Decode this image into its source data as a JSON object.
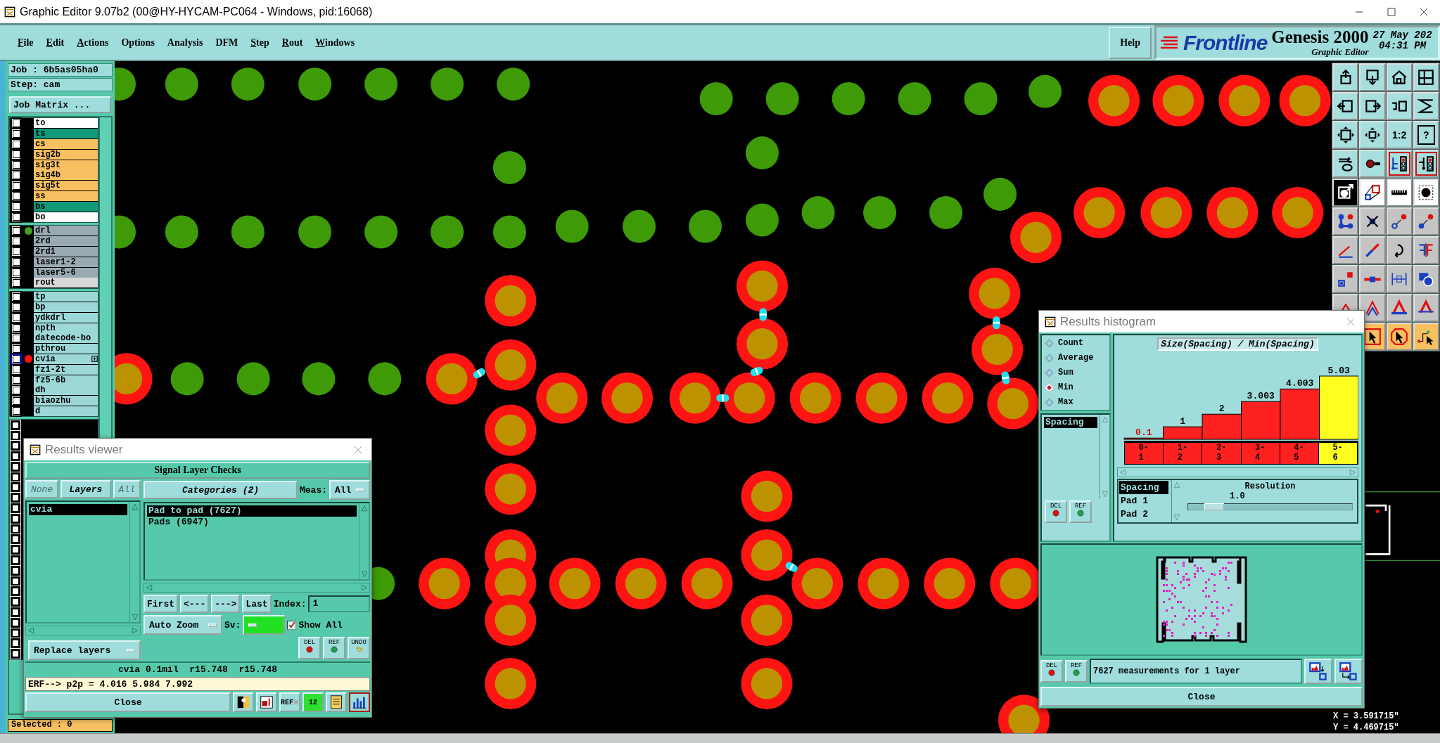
{
  "window": {
    "title": "Graphic Editor 9.07b2 (00@HY-HYCAM-PC064 - Windows, pid:16068)"
  },
  "menu": [
    {
      "label": "File",
      "mnemonic": true
    },
    {
      "label": "Edit",
      "mnemonic": true
    },
    {
      "label": "Actions",
      "mnemonic": true
    },
    {
      "label": "Options",
      "mnemonic": false
    },
    {
      "label": "Analysis",
      "mnemonic": false
    },
    {
      "label": "DFM",
      "mnemonic": false
    },
    {
      "label": "Step",
      "mnemonic": true
    },
    {
      "label": "Rout",
      "mnemonic": true
    },
    {
      "label": "Windows",
      "mnemonic": true
    }
  ],
  "help": "Help",
  "brand": {
    "logo": "Frontline",
    "product": "Genesis 2000",
    "subtitle": "Graphic Editor",
    "date": "27 May 202",
    "time": "04:31 PM"
  },
  "job": {
    "job": "Job : 6b5as05ha0",
    "step": "Step: cam",
    "matrix_button": "Job Matrix ..."
  },
  "layer_groups": [
    {
      "layers": [
        {
          "name": "to",
          "color": "#ffffff",
          "checked": false,
          "focused": false
        },
        {
          "name": "ts",
          "color": "#119a7a",
          "checked": false,
          "focused": false
        },
        {
          "name": "cs",
          "color": "#f8c060",
          "checked": false,
          "focused": false
        },
        {
          "name": "sig2b",
          "color": "#f8c060",
          "checked": false,
          "focused": false
        },
        {
          "name": "sig3t",
          "color": "#f8c060",
          "checked": false,
          "focused": false
        },
        {
          "name": "sig4b",
          "color": "#f8c060",
          "checked": false,
          "focused": false
        },
        {
          "name": "sig5t",
          "color": "#f8c060",
          "checked": false,
          "focused": false
        },
        {
          "name": "ss",
          "color": "#f8c060",
          "checked": false,
          "focused": false
        },
        {
          "name": "bs",
          "color": "#119a7a",
          "checked": false,
          "focused": false
        },
        {
          "name": "bo",
          "color": "#ffffff",
          "checked": false,
          "focused": false
        }
      ]
    },
    {
      "layers": [
        {
          "name": "drl",
          "color": "#9aaab2",
          "checked": false,
          "focused": false,
          "dot": {
            "color": "#40a020"
          }
        },
        {
          "name": "2rd",
          "color": "#9aaab2",
          "checked": false,
          "focused": false
        },
        {
          "name": "2rd1",
          "color": "#9aaab2",
          "checked": false,
          "focused": false
        },
        {
          "name": "laser1-2",
          "color": "#9aaab2",
          "checked": false,
          "focused": false
        },
        {
          "name": "laser5-6",
          "color": "#9aaab2",
          "checked": false,
          "focused": false
        },
        {
          "name": "rout",
          "color": "#d8d8d8",
          "checked": false,
          "focused": false
        }
      ]
    },
    {
      "layers": [
        {
          "name": "tp",
          "color": "#9cd8d8",
          "checked": false,
          "focused": false
        },
        {
          "name": "bp",
          "color": "#9cd8d8",
          "checked": false,
          "focused": false
        },
        {
          "name": "ydkdrl",
          "color": "#9cd8d8",
          "checked": false,
          "focused": false
        },
        {
          "name": "npth",
          "color": "#9cd8d8",
          "checked": false,
          "focused": false
        },
        {
          "name": "datecode-bo",
          "color": "#9cd8d8",
          "checked": false,
          "focused": false
        },
        {
          "name": "pthrou",
          "color": "#9cd8d8",
          "checked": false,
          "focused": false
        },
        {
          "name": "cvia",
          "color": "#9cd8d8",
          "checked": false,
          "focused": true,
          "dot": {
            "color": "#ff1010"
          },
          "expandable": true
        },
        {
          "name": "fz1-2t",
          "color": "#9cd8d8",
          "checked": false,
          "focused": false
        },
        {
          "name": "fz5-6b",
          "color": "#9cd8d8",
          "checked": false,
          "focused": false
        },
        {
          "name": "dh",
          "color": "#9cd8d8",
          "checked": false,
          "focused": false
        },
        {
          "name": "biaozhu",
          "color": "#9cd8d8",
          "checked": false,
          "focused": false
        },
        {
          "name": "d",
          "color": "#9cd8d8",
          "checked": false,
          "focused": false
        }
      ]
    }
  ],
  "extra_rows": [
    {
      "checked": false
    },
    {
      "checked": false
    },
    {
      "checked": false
    },
    {
      "checked": false
    },
    {
      "checked": false
    },
    {
      "checked": false
    },
    {
      "checked": false
    },
    {
      "checked": false
    },
    {
      "checked": false
    },
    {
      "checked": false
    },
    {
      "checked": false
    },
    {
      "checked": false
    },
    {
      "checked": false
    },
    {
      "checked": false
    },
    {
      "checked": false
    },
    {
      "checked": false
    },
    {
      "checked": false
    },
    {
      "checked": false
    },
    {
      "checked": false
    },
    {
      "checked": false
    },
    {
      "checked": false
    },
    {
      "checked": false
    },
    {
      "checked": false
    }
  ],
  "status": "Selected : 0",
  "toolbar": {
    "ratio": "1:2",
    "help": "?"
  },
  "coords": [
    "X = 3.591715\"",
    "Y = 4.469715\""
  ],
  "results_viewer": {
    "title": "Results viewer",
    "heading": "Signal Layer Checks",
    "layer_buttons": [
      {
        "label": "None",
        "disabled": true
      },
      {
        "label": "Layers",
        "disabled": false
      },
      {
        "label": "All",
        "disabled": true
      }
    ],
    "layers": [
      {
        "label": "cvia",
        "selected": true
      }
    ],
    "categories_button": "Categories (2)",
    "meas_label": "Meas:",
    "meas_value": "All",
    "categories": [
      {
        "label": "Pad to pad (7627)",
        "selected": true
      },
      {
        "label": "Pads (6947)",
        "selected": false
      }
    ],
    "nav": [
      "First",
      "<---",
      "--->",
      "Last"
    ],
    "index_label": "Index:",
    "index_value": "1",
    "zoom_mode": "Auto Zoom",
    "sv_label": "Sv:",
    "show_all": {
      "label": "Show All",
      "checked": true
    },
    "action_buttons": [
      "DEL",
      "REF",
      "UNDO"
    ],
    "replace": "Replace layers",
    "info": "cvia 0.1mil  r15.748  r15.748",
    "erf": "ERF--> p2p = 4.016 5.984 7.992",
    "close": "Close",
    "ref_crossed": "REF",
    "count_label": "12"
  },
  "histogram": {
    "title": "Results histogram",
    "modes": [
      {
        "label": "Count",
        "selected": false
      },
      {
        "label": "Average",
        "selected": false
      },
      {
        "label": "Sum",
        "selected": false
      },
      {
        "label": "Min",
        "selected": true
      },
      {
        "label": "Max",
        "selected": false
      }
    ],
    "fields": [
      {
        "label": "Spacing",
        "selected": true
      }
    ],
    "list_buttons": [
      "DEL",
      "REF"
    ],
    "chart_data": {
      "type": "bar",
      "title": "Size(Spacing) / Min(Spacing)",
      "categories": [
        "0-1",
        "1-2",
        "2-3",
        "3-4",
        "4-5",
        "5-6"
      ],
      "series": [
        {
          "color": "#ff2020",
          "values": [
            0.1,
            1,
            2,
            3.003,
            4.003,
            null
          ]
        },
        {
          "color": "#ffff20",
          "values": [
            null,
            null,
            null,
            null,
            null,
            5.03
          ]
        }
      ],
      "data_labels": true
    },
    "attributes": [
      {
        "label": "Spacing",
        "selected": true
      },
      {
        "label": "Pad 1",
        "selected": false
      },
      {
        "label": "Pad 2",
        "selected": false
      }
    ],
    "resolution": {
      "label": "Resolution",
      "value": "1.0",
      "level": 0.1
    },
    "bottom_buttons": [
      "DEL",
      "REF"
    ],
    "summary": "7627 measurements for 1 layer",
    "close": "Close"
  }
}
